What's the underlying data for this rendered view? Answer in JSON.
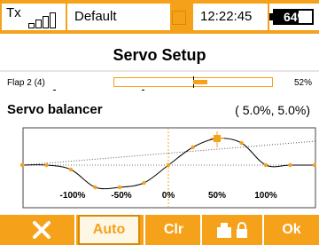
{
  "status_bar": {
    "tx_label": "Tx",
    "model_name": "Default",
    "time": "12:22:45",
    "battery_text": "64%",
    "battery_level": 0.64,
    "accent": "#f5a21a"
  },
  "page": {
    "title": "Servo Setup"
  },
  "channel": {
    "label": "Flap 2 (4)",
    "value_text": "52%",
    "value": 52
  },
  "balancer": {
    "label": "Servo balancer",
    "values_text": "( 5.0%, 5.0%)"
  },
  "curve": {
    "x_ticks": [
      "-100%",
      "-50%",
      "0%",
      "50%",
      "100%"
    ],
    "points": [
      [
        -150,
        0
      ],
      [
        -125,
        0
      ],
      [
        -100,
        -5
      ],
      [
        -75,
        -25
      ],
      [
        -50,
        -25
      ],
      [
        -25,
        -20
      ],
      [
        0,
        0
      ],
      [
        25,
        20
      ],
      [
        50,
        30
      ],
      [
        75,
        25
      ],
      [
        100,
        0
      ],
      [
        125,
        0
      ],
      [
        150,
        0
      ]
    ],
    "marker_x": 50
  },
  "toolbar": {
    "tools_icon": "tools-icon",
    "auto_label": "Auto",
    "clr_label": "Clr",
    "lock_icon": "servo-lock-icon",
    "ok_label": "Ok"
  }
}
